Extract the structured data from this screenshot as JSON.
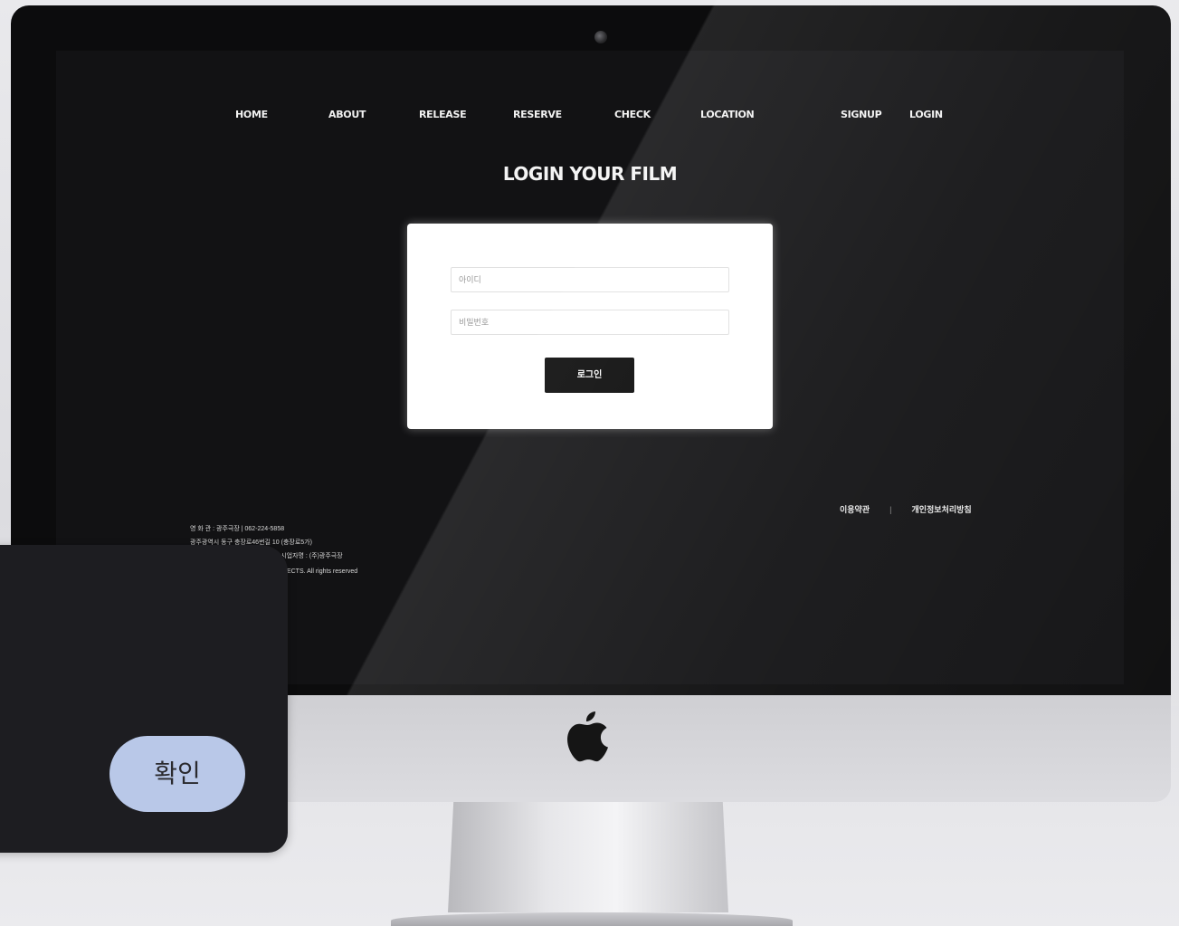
{
  "site": {
    "nav": {
      "items": [
        {
          "label": "HOME"
        },
        {
          "label": "ABOUT"
        },
        {
          "label": "RELEASE"
        },
        {
          "label": "RESERVE"
        },
        {
          "label": "CHECK"
        },
        {
          "label": "LOCATION"
        }
      ],
      "signup": "SIGNUP",
      "login": "LOGIN"
    },
    "headline": "LOGIN YOUR FILM",
    "form": {
      "id_placeholder": "아이디",
      "password_placeholder": "비밀번호",
      "submit_label": "로그인"
    },
    "footer": {
      "lines": [
        "영 화 관 : 광주극장 | 062-224-5858",
        "광주광역시 동구 충장로46번길 10 (충장로5가)",
        "사업자등록번호 : 400-45-56561 | 시업자명 : (주)광주극장",
        "© 2024 LOGIN YOUR FILM PROJECTS. All rights reserved"
      ],
      "terms_link": "이용약관",
      "privacy_link": "개인정보처리방침",
      "separator": "|"
    }
  },
  "dialog": {
    "confirm_label": "확인"
  }
}
